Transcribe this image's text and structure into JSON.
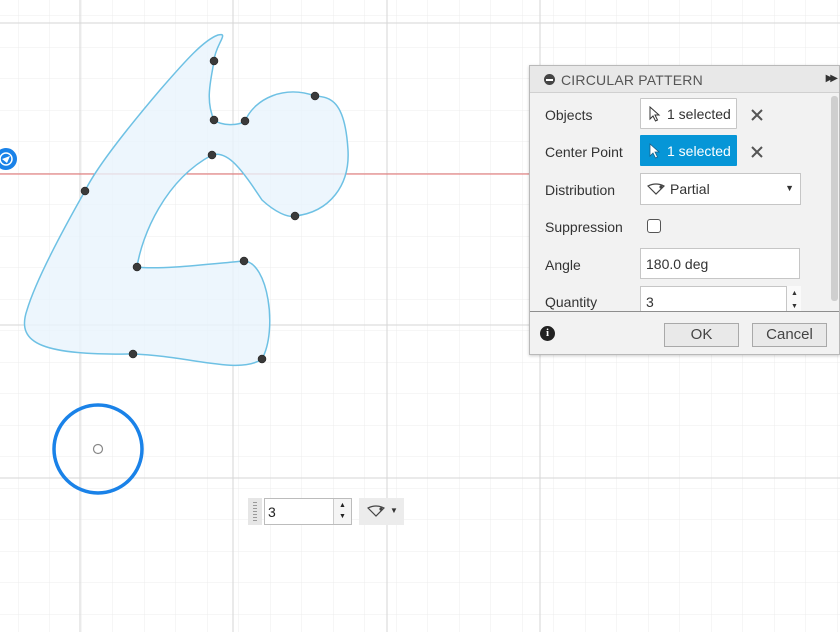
{
  "panel": {
    "title": "CIRCULAR PATTERN",
    "rows": {
      "objects": {
        "label": "Objects",
        "value": "1 selected"
      },
      "center_point": {
        "label": "Center Point",
        "value": "1 selected"
      },
      "distribution": {
        "label": "Distribution",
        "value": "Partial"
      },
      "suppression": {
        "label": "Suppression",
        "checked": false
      },
      "angle": {
        "label": "Angle",
        "value": "180.0 deg"
      },
      "quantity": {
        "label": "Quantity",
        "value": "3"
      }
    },
    "ok_label": "OK",
    "cancel_label": "Cancel",
    "info_glyph": "i"
  },
  "canvas_quantity_input": {
    "value": "3"
  },
  "icons": [
    "collapse-icon",
    "expand-icon",
    "cursor-icon",
    "clear-icon",
    "partial-icon",
    "chevron-down-icon",
    "info-icon",
    "pattern-origin-icon"
  ],
  "colors": {
    "accent_blue": "#0696d7",
    "sketch_fill": "#e8f4fc",
    "sketch_stroke": "#6ec1e4",
    "circle_stroke": "#1a82e8",
    "axis_red": "#e06a6a",
    "grid": "#e4e4e4"
  }
}
